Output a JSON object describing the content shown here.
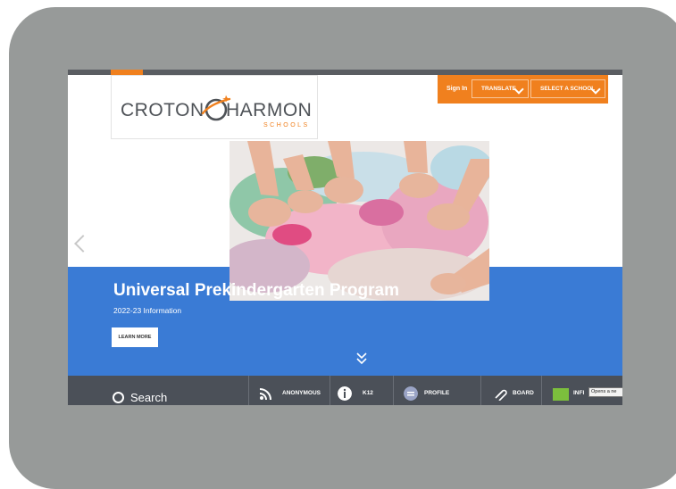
{
  "header": {
    "logo": {
      "left_word": "CROTON",
      "right_word": "HARMON",
      "sub_word": "SCHOOLS"
    },
    "sign_in_label": "Sign In",
    "translate_label": "TRANSLATE",
    "select_school_label": "SELECT A SCHOOL"
  },
  "hero": {
    "title": "Universal Prekindergarten Program",
    "subtitle": "2022-23 Information",
    "button_label": "LEARN MORE"
  },
  "quicklinks": {
    "search_label": "Search",
    "items": [
      {
        "label": "ANONYMOUS",
        "icon": "rss-icon"
      },
      {
        "label": "K12",
        "icon": "info-icon"
      },
      {
        "label": "PROFILE",
        "icon": "profile-icon"
      },
      {
        "label": "BOARD",
        "icon": "paperclip-icon"
      },
      {
        "label": "INFI",
        "icon": "infinite-campus-icon"
      }
    ],
    "tooltip": "Opens a ne"
  },
  "colors": {
    "accent": "#f0801e",
    "hero_blue": "#3a7bd5",
    "quickbar": "#4b5058",
    "device_frame": "#979a99"
  }
}
